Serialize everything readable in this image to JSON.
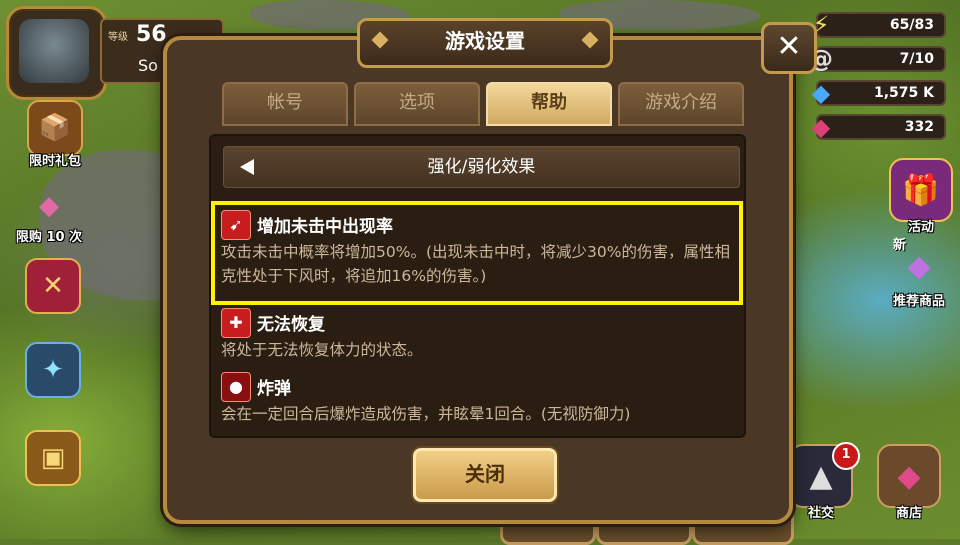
{
  "hud": {
    "level_label": "等级",
    "level_value": "56",
    "player_name": "So",
    "left_buttons": [
      {
        "label": "限时礼包",
        "icon": "gift-pack-icon"
      },
      {
        "label": "限购 10 次",
        "icon": "crystal-icon"
      },
      {
        "label": "",
        "icon": "banner-icon"
      },
      {
        "label": "",
        "icon": "blue-flame-icon"
      },
      {
        "label": "",
        "icon": "treasure-chest-icon"
      }
    ],
    "resources": [
      {
        "value": "65/83",
        "icon": "energy-bolt-icon"
      },
      {
        "value": "7/10",
        "icon": "wind-swirl-icon"
      },
      {
        "value": "1,575 K",
        "icon": "blue-crystal-icon"
      },
      {
        "value": "332",
        "icon": "red-crystal-icon"
      }
    ],
    "right_buttons": [
      {
        "label": "活动",
        "icon": "gift-box-icon"
      },
      {
        "label": "推荐商品",
        "icon": "new-items-icon",
        "tag": "新"
      }
    ],
    "bottom_tabs": [
      {
        "label": "社交",
        "badge": "1",
        "icon": "social-wizard-icon"
      },
      {
        "label": "商店",
        "icon": "shop-crystal-icon"
      }
    ]
  },
  "dialog": {
    "title": "游戏设置",
    "close_label": "✕",
    "tabs": [
      {
        "label": "帐号",
        "active": false
      },
      {
        "label": "选项",
        "active": false
      },
      {
        "label": "帮助",
        "active": true
      },
      {
        "label": "游戏介绍",
        "active": false
      }
    ],
    "section_title": "强化/弱化效果",
    "effects": [
      {
        "name": "增加未击中出现率",
        "description": "攻击未击中概率将增加50%。(出现未击中时，将减少30%的伤害，属性相克性处于下风时，将追加16%的伤害。)",
        "icon": "miss-up-icon"
      },
      {
        "name": "无法恢复",
        "description": "将处于无法恢复体力的状态。",
        "icon": "no-heal-icon"
      },
      {
        "name": "炸弹",
        "description": "会在一定回合后爆炸造成伤害，并眩晕1回合。(无视防御力)",
        "icon": "bomb-icon"
      }
    ],
    "close_button_label": "关闭"
  },
  "colors": {
    "highlight": "#fff200",
    "tab_active": "#e3c07e",
    "effect_icon": "#c61e1e"
  }
}
